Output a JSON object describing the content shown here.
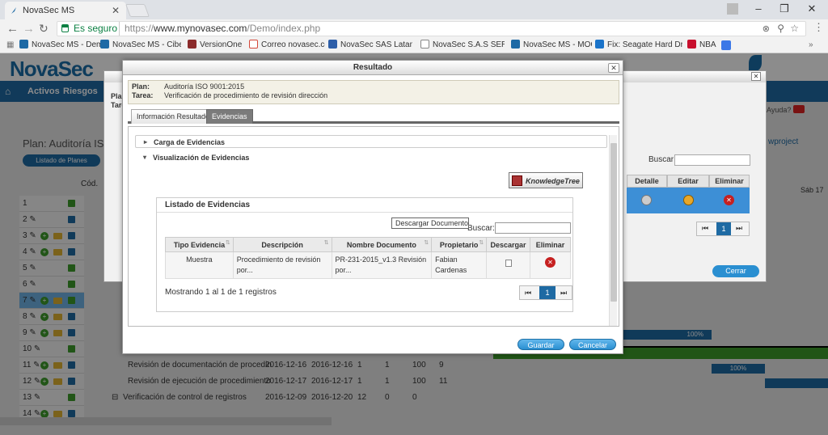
{
  "browser": {
    "tab_title": "NovaSec MS",
    "secure_label": "Es seguro",
    "url_prefix": "https://",
    "url_host": "www.mynovasec.com",
    "url_path": "/Demo/index.php",
    "bookmarks": [
      {
        "label": "NovaSec MS - Demo",
        "color": "#1f6aa5"
      },
      {
        "label": "NovaSec MS - Ciber",
        "color": "#1f6aa5"
      },
      {
        "label": "VersionOne",
        "color": "#8b2b2b"
      },
      {
        "label": "Correo novasec.co",
        "color": "#d44638"
      },
      {
        "label": "NovaSec SAS Latam",
        "color": "#2d5ea8"
      },
      {
        "label": "NovaSec S.A.S SERVI",
        "color": "#888888"
      },
      {
        "label": "NovaSec MS - MOC",
        "color": "#1f6aa5"
      },
      {
        "label": "Fix: Seagate Hard Dr",
        "color": "#1a73c9"
      },
      {
        "label": "NBA",
        "color": "#c8102e"
      }
    ]
  },
  "app": {
    "logo": "NovaSec",
    "nav": [
      "Activos",
      "Riesgos"
    ],
    "plan_title": "Plan: Auditoría ISO",
    "listado_planes": "Listado de Planes",
    "col_cod": "Cód.",
    "rows": [
      "1",
      "2",
      "3",
      "4",
      "5",
      "6",
      "7",
      "8",
      "9",
      "10",
      "11",
      "12",
      "13",
      "14"
    ],
    "bg_rows": [
      {
        "name": "Revisión de documentación de procedin",
        "start": "2016-12-16",
        "end": "2016-12-16",
        "a": "1",
        "b": "1",
        "c": "100",
        "d": "9"
      },
      {
        "name": "Revisión de ejecución de procedimiento",
        "start": "2016-12-17",
        "end": "2016-12-17",
        "a": "1",
        "b": "1",
        "c": "100",
        "d": "11"
      },
      {
        "name": "Verificación de control de registros",
        "start": "2016-12-09",
        "end": "2016-12-20",
        "a": "12",
        "b": "0",
        "c": "0",
        "d": ""
      }
    ],
    "gantt_pct": [
      "100%",
      "100%"
    ],
    "ayuda": "Ayuda?",
    "project_link": "wproject",
    "sab": "Sáb 17"
  },
  "back_dialog": {
    "plan_short": "Plan",
    "tarea_short": "Tare",
    "buscar": "Buscar:",
    "cols": [
      "Detalle",
      "Editar",
      "Eliminar"
    ],
    "page": "1",
    "cerrar": "Cerrar"
  },
  "dialog": {
    "title": "Resultado",
    "plan_label": "Plan:",
    "plan_value": "Auditoría ISO 9001:2015",
    "tarea_label": "Tarea:",
    "tarea_value": "Verificación de procedimiento de revisión dirección",
    "tabs": [
      "Información Resultado",
      "Evidencias"
    ],
    "accordion": [
      "Carga de Evidencias",
      "Visualización de Evidencias"
    ],
    "kt_logo": "KnowledgeTree",
    "evidencias": {
      "title": "Listado de Evidencias",
      "buscar": "Buscar:",
      "headers": [
        "Tipo Evidencia",
        "Descripción",
        "Nombre Documento",
        "Propietario",
        "Descargar",
        "Eliminar"
      ],
      "row": {
        "tipo": "Muestra",
        "descripcion": "Procedimiento de revisión por...",
        "documento": "PR-231-2015_v1.3 Revisión por...",
        "propietario": "Fabian Cardenas"
      },
      "info": "Mostrando 1 al 1 de 1 registros",
      "page": "1"
    },
    "tooltip": "Descargar Documento",
    "guardar": "Guardar",
    "cancelar": "Cancelar"
  }
}
